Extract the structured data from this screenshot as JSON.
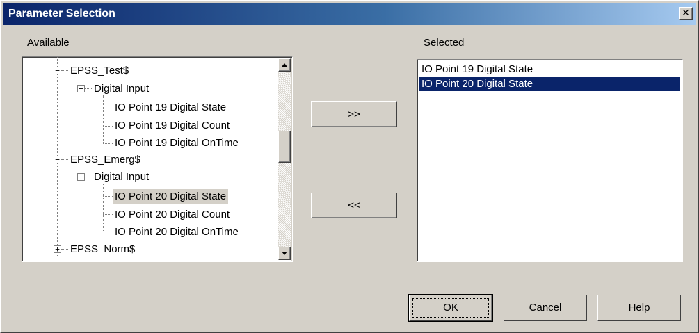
{
  "window": {
    "title": "Parameter Selection",
    "close_glyph": "✕"
  },
  "available": {
    "label": "Available",
    "tree": [
      {
        "text": "EPSS_Test$",
        "expander": "−"
      },
      {
        "text": "Digital Input",
        "expander": "−"
      },
      {
        "text": "IO Point 19 Digital State"
      },
      {
        "text": "IO Point 19 Digital Count"
      },
      {
        "text": "IO Point 19 Digital OnTime"
      },
      {
        "text": "EPSS_Emerg$",
        "expander": "−"
      },
      {
        "text": "Digital Input",
        "expander": "−"
      },
      {
        "text": "IO Point 20 Digital State",
        "selected": true
      },
      {
        "text": "IO Point 20 Digital Count"
      },
      {
        "text": "IO Point 20 Digital OnTime"
      },
      {
        "text": "EPSS_Norm$",
        "expander": "+"
      }
    ]
  },
  "transfer": {
    "add_label": ">>",
    "remove_label": "<<"
  },
  "selected": {
    "label": "Selected",
    "items": [
      {
        "text": "IO Point 19 Digital State",
        "selected": false
      },
      {
        "text": "IO Point 20 Digital State",
        "selected": true
      }
    ]
  },
  "buttons": {
    "ok": "OK",
    "cancel": "Cancel",
    "help": "Help"
  },
  "colors": {
    "dialog_bg": "#d4d0c8",
    "title_gradient_start": "#0a246a",
    "title_gradient_end": "#a6caf0",
    "selection": "#0a246a"
  }
}
